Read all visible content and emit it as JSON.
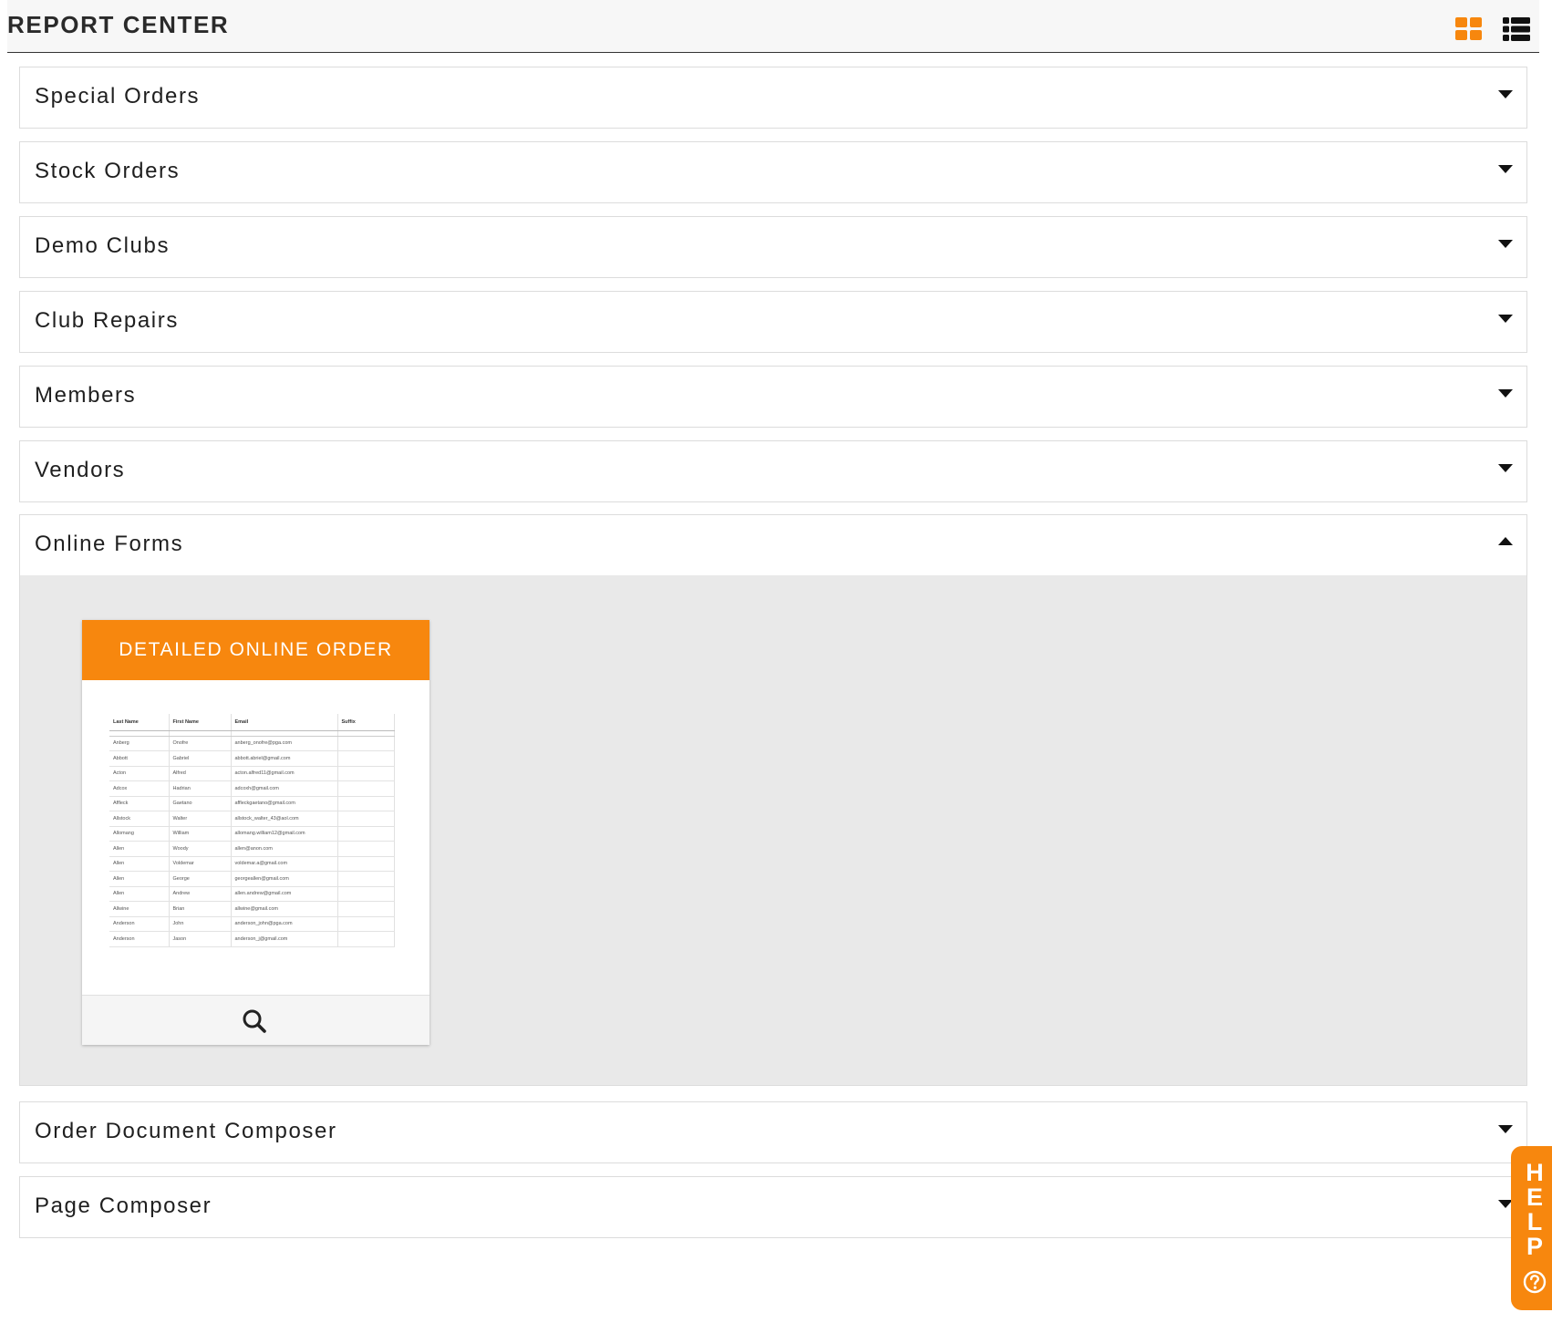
{
  "header": {
    "title": "REPORT CENTER",
    "colors": {
      "accent": "#f7870e"
    },
    "view_toggle_icons": [
      "grid-view-icon",
      "list-view-icon"
    ]
  },
  "accordion": {
    "sections": [
      {
        "label": "Special Orders",
        "expanded": false
      },
      {
        "label": "Stock Orders",
        "expanded": false
      },
      {
        "label": "Demo Clubs",
        "expanded": false
      },
      {
        "label": "Club Repairs",
        "expanded": false
      },
      {
        "label": "Members",
        "expanded": false
      },
      {
        "label": "Vendors",
        "expanded": false
      },
      {
        "label": "Online Forms",
        "expanded": true
      },
      {
        "label": "Order Document Composer",
        "expanded": false
      },
      {
        "label": "Page Composer",
        "expanded": false
      }
    ]
  },
  "online_forms": {
    "card": {
      "title": "DETAILED ONLINE ORDER",
      "footer_icon": "search-icon",
      "thumbnail": {
        "headers": [
          "Last Name",
          "First Name",
          "Email",
          "Suffix"
        ],
        "rows": [
          [
            "Anberg",
            "Onofre",
            "anberg_onofre@pga.com",
            ""
          ],
          [
            "Abbott",
            "Gabriel",
            "abbott.abriel@gmail.com",
            ""
          ],
          [
            "Acton",
            "Alfred",
            "acton.alfred11@gmail.com",
            ""
          ],
          [
            "Adcox",
            "Hadrian",
            "adcoxh@gmail.com",
            ""
          ],
          [
            "Affleck",
            "Gaetano",
            "affleckgaetano@gmail.com",
            ""
          ],
          [
            "Allstock",
            "Walter",
            "allstock_walter_43@aol.com",
            ""
          ],
          [
            "Allomang",
            "William",
            "allomang.william12@gmail.com",
            ""
          ],
          [
            "Allen",
            "Woody",
            "allen@anon.com",
            ""
          ],
          [
            "Allen",
            "Voldemar",
            "voldemar.a@gmail.com",
            ""
          ],
          [
            "Allen",
            "George",
            "georgeallen@gmail.com",
            ""
          ],
          [
            "Allen",
            "Andrew",
            "allen.andrew@gmail.com",
            ""
          ],
          [
            "Allwine",
            "Brian",
            "allwine@gmail.com",
            ""
          ],
          [
            "Anderson",
            "John",
            "anderson_john@pga.com",
            ""
          ],
          [
            "Anderson",
            "Jason",
            "anderson_j@gmail.com",
            ""
          ]
        ]
      }
    }
  },
  "help_tab": {
    "letters": [
      "H",
      "E",
      "L",
      "P"
    ],
    "icon": "question-circle-icon"
  }
}
